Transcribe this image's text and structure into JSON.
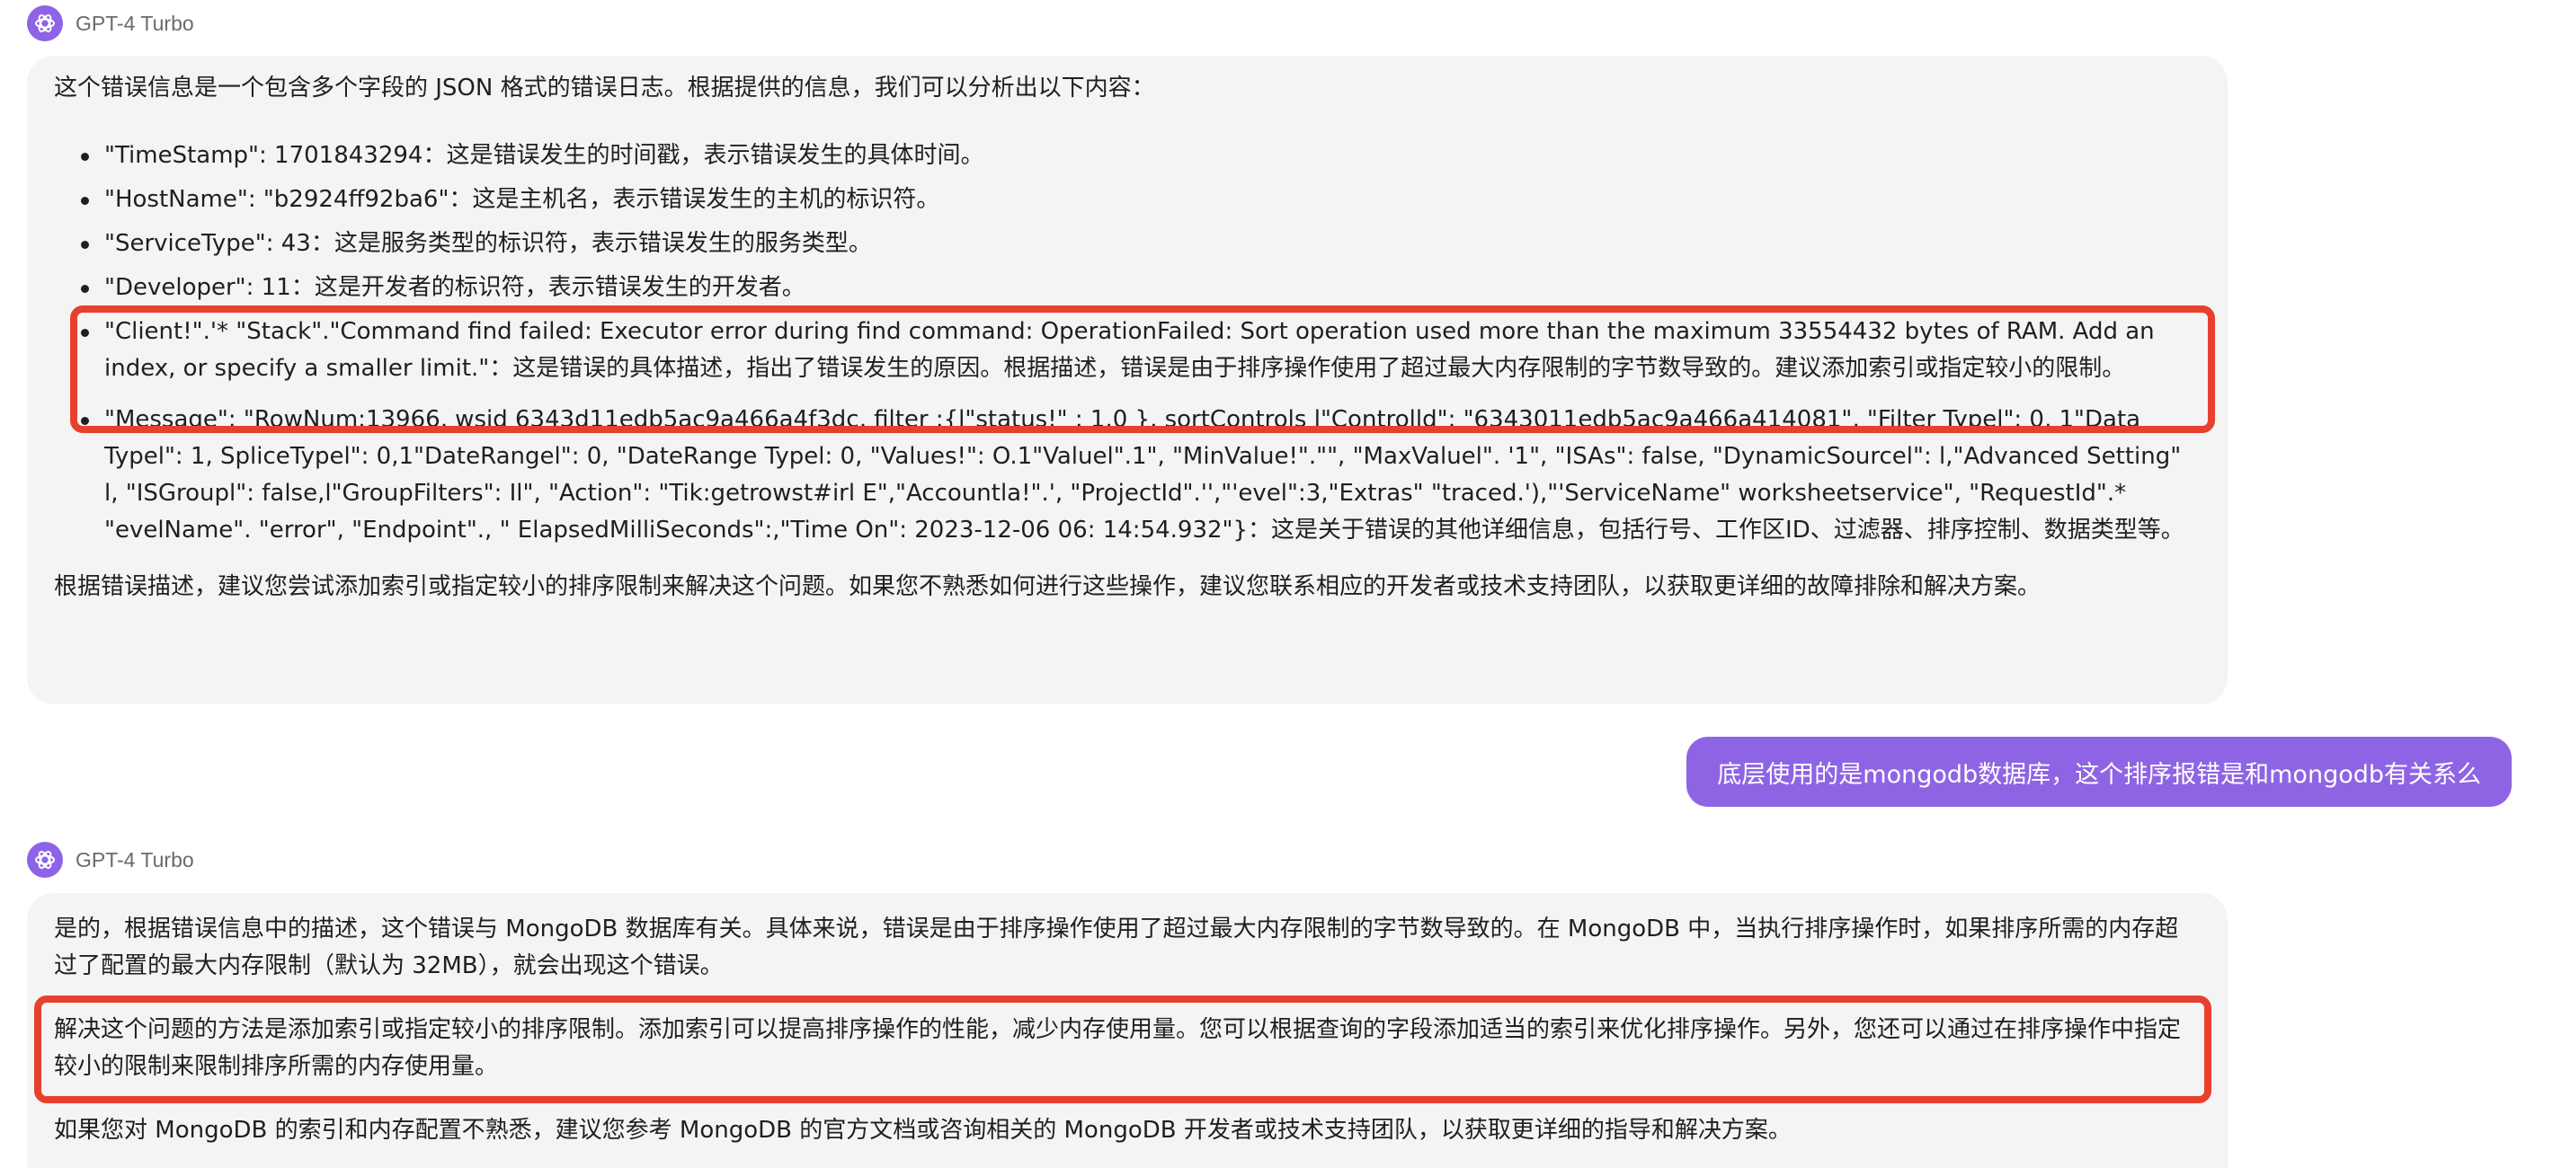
{
  "assistant_name": "GPT-4 Turbo",
  "colors": {
    "accent_purple": "#8f64e4",
    "highlight_red": "#e8402e",
    "bubble_gray": "#f4f4f4"
  },
  "icons": {
    "assistant_avatar": "openai-logo-icon"
  },
  "message1": {
    "intro": "这个错误信息是一个包含多个字段的 JSON 格式的错误日志。根据提供的信息，我们可以分析出以下内容：",
    "items": [
      "\"TimeStamp\": 1701843294：这是错误发生的时间戳，表示错误发生的具体时间。",
      "\"HostName\": \"b2924ff92ba6\"：这是主机名，表示错误发生的主机的标识符。",
      "\"ServiceType\": 43：这是服务类型的标识符，表示错误发生的服务类型。",
      "\"Developer\": 11：这是开发者的标识符，表示错误发生的开发者。",
      "\"Client!\".'* \"Stack\".\"Command find failed: Executor error during find command: OperationFailed: Sort operation used more than the maximum 33554432 bytes of RAM. Add an index, or specify a smaller limit.\"：这是错误的具体描述，指出了错误发生的原因。根据描述，错误是由于排序操作使用了超过最大内存限制的字节数导致的。建议添加索引或指定较小的限制。",
      "\"Message\": \"RowNum:13966, wsid 6343d11edb5ac9a466a4f3dc, filter :{l\"status!\" : 1.0 }, sortControls l\"Controlld\": \"6343011edb5ac9a466a414081\", \"Filter Typel\": 0, 1\"Data Typel\": 1, SpliceTypel\": 0,1\"DateRangel\": 0, \"DateRange Typel: 0, \"Values!\": O.1\"Valuel\".1\", \"MinValue!\".\"\", \"MaxValuel\". '1\", \"ISAs\": false, \"DynamicSourcel\": l,\"Advanced Setting\" l, \"ISGroupl\": false,l\"GroupFilters\": Il\", \"Action\": \"Tik:getrowst#irl E\",\"Accountla!\".', \"ProjectId\".'',\"'evel\":3,\"Extras\" \"traced.'),\"'ServiceName\" worksheetservice\", \"RequestId\".* \"evelName\". \"error\", \"Endpoint\"., \" ElapsedMilliSeconds\":,\"Time On\": 2023-12-06 06: 14:54.932\"}：这是关于错误的其他详细信息，包括行号、工作区ID、过滤器、排序控制、数据类型等。"
    ],
    "conclusion": "根据错误描述，建议您尝试添加索引或指定较小的排序限制来解决这个问题。如果您不熟悉如何进行这些操作，建议您联系相应的开发者或技术支持团队，以获取更详细的故障排除和解决方案。"
  },
  "user_message": "底层使用的是mongodb数据库，这个排序报错是和mongodb有关系么",
  "message2": {
    "para1": "是的，根据错误信息中的描述，这个错误与 MongoDB 数据库有关。具体来说，错误是由于排序操作使用了超过最大内存限制的字节数导致的。在 MongoDB 中，当执行排序操作时，如果排序所需的内存超过了配置的最大内存限制（默认为 32MB），就会出现这个错误。",
    "para2": "解决这个问题的方法是添加索引或指定较小的排序限制。添加索引可以提高排序操作的性能，减少内存使用量。您可以根据查询的字段添加适当的索引来优化排序操作。另外，您还可以通过在排序操作中指定较小的限制来限制排序所需的内存使用量。",
    "para3": "如果您对 MongoDB 的索引和内存配置不熟悉，建议您参考 MongoDB 的官方文档或咨询相关的 MongoDB 开发者或技术支持团队，以获取更详细的指导和解决方案。"
  }
}
